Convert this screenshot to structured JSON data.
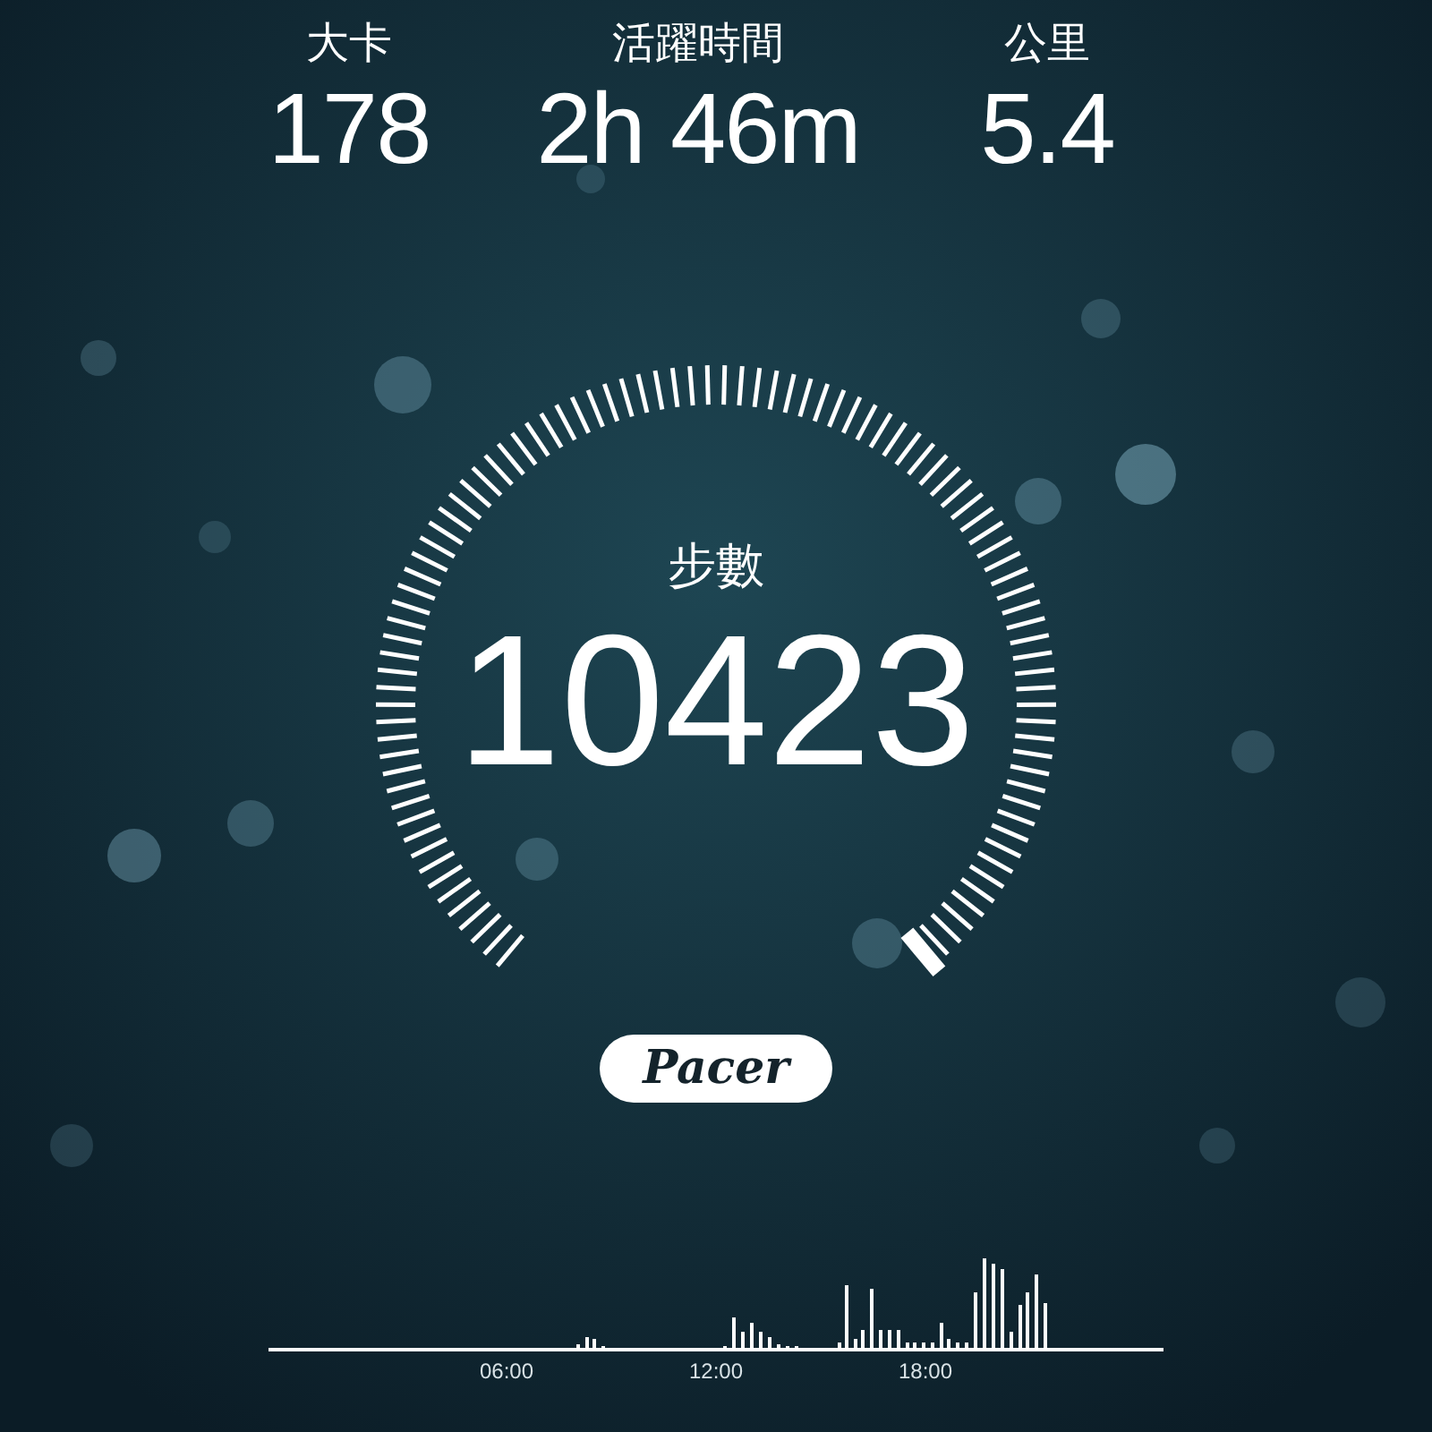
{
  "stats": [
    {
      "label": "大卡",
      "value": "178"
    },
    {
      "label": "活躍時間",
      "value": "2h 46m"
    },
    {
      "label": "公里",
      "value": "5.4"
    }
  ],
  "steps": {
    "label": "步數",
    "value": "10423"
  },
  "logo": "Pacer",
  "activity_chart": {
    "axis_labels": [
      "06:00",
      "12:00",
      "18:00"
    ]
  }
}
